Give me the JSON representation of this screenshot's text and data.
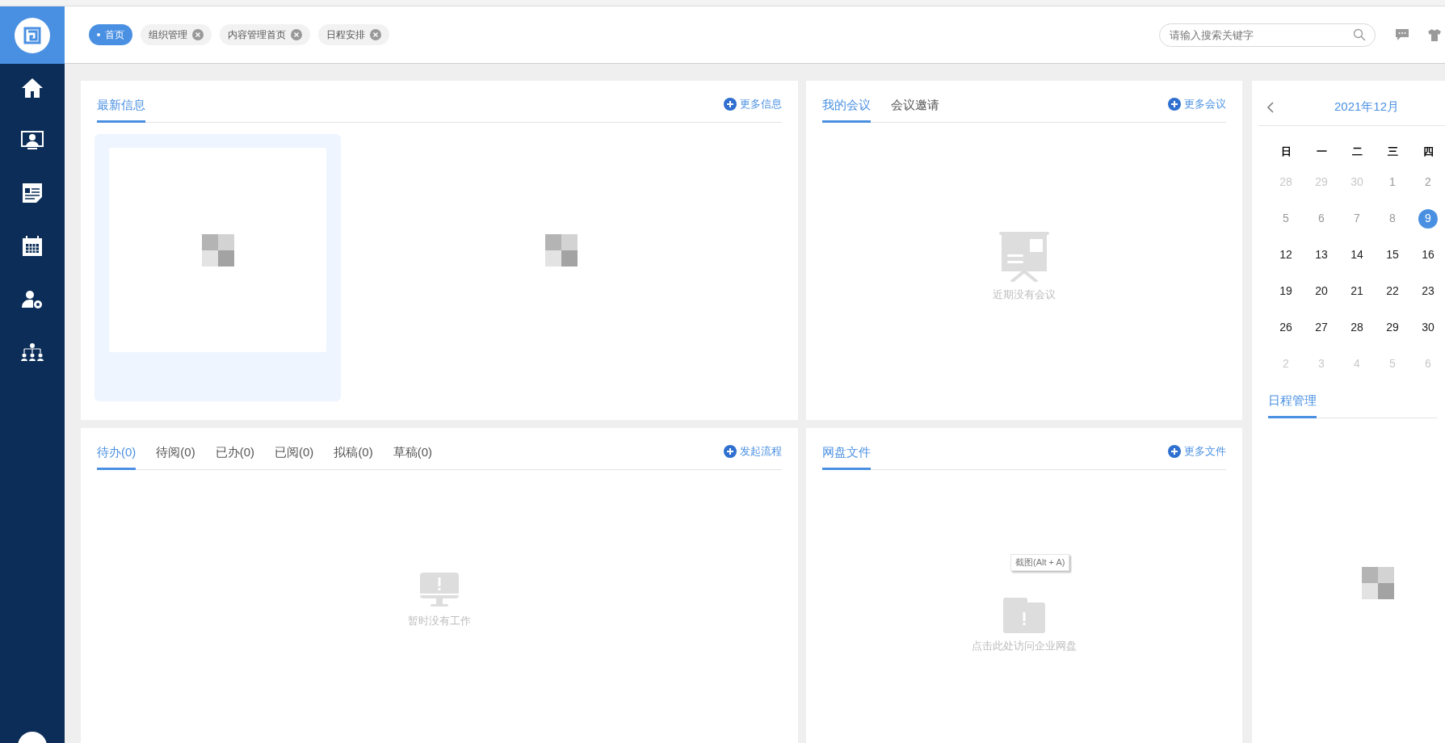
{
  "header": {
    "tabs": [
      {
        "label": "首页",
        "selected": true,
        "closable": false
      },
      {
        "label": "组织管理",
        "selected": false,
        "closable": true
      },
      {
        "label": "内容管理首页",
        "selected": false,
        "closable": true
      },
      {
        "label": "日程安排",
        "selected": false,
        "closable": true
      }
    ],
    "search": {
      "placeholder": "请输入搜索关键字"
    }
  },
  "news": {
    "tabs": [
      {
        "label": "最新信息",
        "selected": true
      }
    ],
    "more": "更多信息",
    "cards": [
      {
        "kind": "picture",
        "highlighted": true
      },
      {
        "kind": "picture",
        "highlighted": false
      }
    ]
  },
  "meetings": {
    "tabs": [
      {
        "label": "我的会议",
        "selected": true
      },
      {
        "label": "会议邀请",
        "selected": false
      }
    ],
    "more": "更多会议",
    "empty": "近期没有会议"
  },
  "calendar": {
    "title": "2021年12月",
    "weekdays": [
      "日",
      "一",
      "二",
      "三",
      "四"
    ],
    "weeks": [
      [
        {
          "day": "28",
          "outside": true,
          "selected": false
        },
        {
          "day": "29",
          "outside": true,
          "selected": false
        },
        {
          "day": "30",
          "outside": true,
          "selected": false
        },
        {
          "day": "1",
          "outside": false,
          "selected": false
        },
        {
          "day": "2",
          "outside": false,
          "selected": false
        }
      ],
      [
        {
          "day": "5",
          "outside": false,
          "selected": false
        },
        {
          "day": "6",
          "outside": false,
          "selected": false
        },
        {
          "day": "7",
          "outside": false,
          "selected": false
        },
        {
          "day": "8",
          "outside": false,
          "selected": false
        },
        {
          "day": "9",
          "outside": false,
          "selected": true
        }
      ],
      [
        {
          "day": "12",
          "outside": false,
          "selected": false
        },
        {
          "day": "13",
          "outside": false,
          "selected": false
        },
        {
          "day": "14",
          "outside": false,
          "selected": false
        },
        {
          "day": "15",
          "outside": false,
          "selected": false
        },
        {
          "day": "16",
          "outside": false,
          "selected": false
        }
      ],
      [
        {
          "day": "19",
          "outside": false,
          "selected": false
        },
        {
          "day": "20",
          "outside": false,
          "selected": false
        },
        {
          "day": "21",
          "outside": false,
          "selected": false
        },
        {
          "day": "22",
          "outside": false,
          "selected": false
        },
        {
          "day": "23",
          "outside": false,
          "selected": false
        }
      ],
      [
        {
          "day": "26",
          "outside": false,
          "selected": false
        },
        {
          "day": "27",
          "outside": false,
          "selected": false
        },
        {
          "day": "28",
          "outside": false,
          "selected": false
        },
        {
          "day": "29",
          "outside": false,
          "selected": false
        },
        {
          "day": "30",
          "outside": false,
          "selected": false
        }
      ],
      [
        {
          "day": "2",
          "outside": true,
          "selected": false
        },
        {
          "day": "3",
          "outside": true,
          "selected": false
        },
        {
          "day": "4",
          "outside": true,
          "selected": false
        },
        {
          "day": "5",
          "outside": true,
          "selected": false
        },
        {
          "day": "6",
          "outside": true,
          "selected": false
        }
      ]
    ],
    "schedule_tabs": [
      {
        "label": "日程管理",
        "selected": true
      }
    ]
  },
  "workflow": {
    "tabs": [
      {
        "label": "待办(0)",
        "selected": true
      },
      {
        "label": "待阅(0)",
        "selected": false
      },
      {
        "label": "已办(0)",
        "selected": false
      },
      {
        "label": "已阅(0)",
        "selected": false
      },
      {
        "label": "拟稿(0)",
        "selected": false
      },
      {
        "label": "草稿(0)",
        "selected": false
      }
    ],
    "more": "发起流程",
    "empty": "暂时没有工作"
  },
  "files": {
    "tabs": [
      {
        "label": "网盘文件",
        "selected": true
      }
    ],
    "more": "更多文件",
    "empty": "点击此处访问企业网盘",
    "tooltip": "截图(Alt + A)"
  }
}
